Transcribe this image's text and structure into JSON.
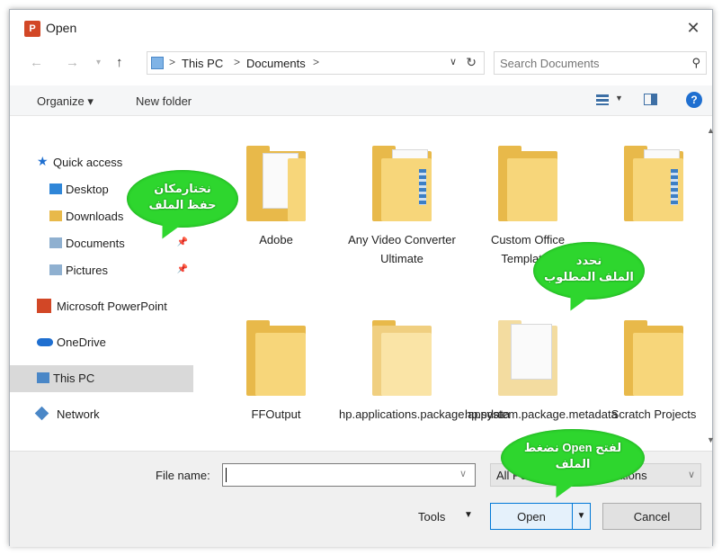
{
  "window": {
    "title": "Open",
    "app_icon": "P",
    "close_icon": "✕"
  },
  "address": {
    "crumbs": [
      "This PC",
      "Documents"
    ],
    "separator": ">",
    "search_placeholder": "Search Documents"
  },
  "toolbar": {
    "organize": "Organize ▾",
    "new_folder": "New folder",
    "help": "?"
  },
  "nav_pane": {
    "items": [
      {
        "label": "Quick access",
        "icon": "star-icon",
        "color": "#1f6fd0"
      },
      {
        "label": "Desktop",
        "icon": "folder-icon",
        "color": "#2f86d8",
        "pinned": true
      },
      {
        "label": "Downloads",
        "icon": "download-icon",
        "color": "#2f86d8",
        "pinned": true
      },
      {
        "label": "Documents",
        "icon": "documents-icon",
        "color": "#8fb0d0",
        "pinned": true
      },
      {
        "label": "Pictures",
        "icon": "pictures-icon",
        "color": "#8fb0d0",
        "pinned": true
      },
      {
        "label": "Microsoft PowerPoint",
        "icon": "powerpoint-icon",
        "color": "#d24726"
      },
      {
        "label": "OneDrive",
        "icon": "cloud-icon",
        "color": "#1f6fd0"
      },
      {
        "label": "This PC",
        "icon": "pc-icon",
        "color": "#4a87c7",
        "selected": true
      },
      {
        "label": "Network",
        "icon": "network-icon",
        "color": "#4a87c7"
      }
    ]
  },
  "files": [
    {
      "name": "Adobe",
      "type": "doc"
    },
    {
      "name": "Any Video Converter Ultimate",
      "type": "doc-strip"
    },
    {
      "name": "Custom Office Templates",
      "type": "plain"
    },
    {
      "name": "",
      "type": "doc-strip"
    },
    {
      "name": "FFOutput",
      "type": "plain"
    },
    {
      "name": "hp.applications.package.appdata",
      "type": "plain"
    },
    {
      "name": "hp.system.package.metadata",
      "type": "paper"
    },
    {
      "name": "Scratch Projects",
      "type": "plain"
    }
  ],
  "bottom": {
    "file_name_label": "File name:",
    "file_name_value": "",
    "filter": "All PowerPoint Presentations",
    "tools": "Tools",
    "open": "Open",
    "cancel": "Cancel"
  },
  "callouts": {
    "choose_location": [
      "نختارمكان",
      "حفظ الملف"
    ],
    "select_file": [
      "نحدد",
      "الملف المطلوب"
    ],
    "press_open": [
      "نضغط Open لفتح",
      "الملف"
    ]
  },
  "colors": {
    "callout": "#2ed62e",
    "accent": "#0078d7",
    "folder": "#e8b94a"
  }
}
